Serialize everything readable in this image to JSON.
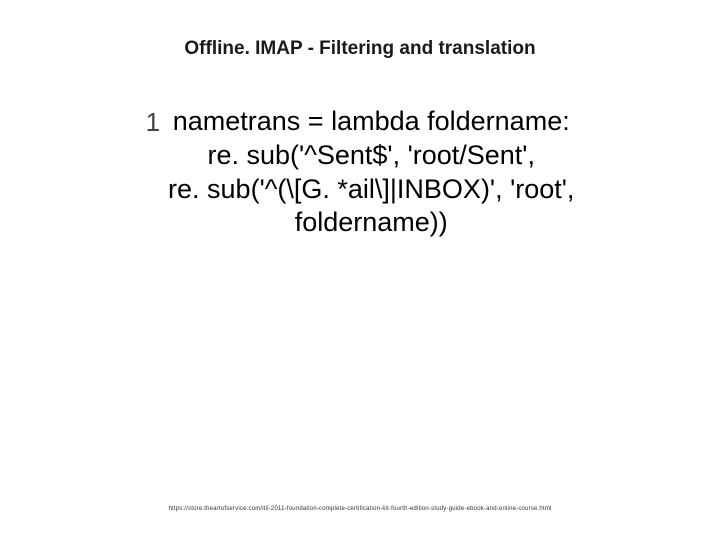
{
  "title": "Offline. IMAP -  Filtering and translation",
  "bullet_number": "1",
  "body_line1": "nametrans = lambda foldername:",
  "body_line2": "re. sub('^Sent$', 'root/Sent',",
  "body_line3": "re. sub('^(\\[G. *ail\\]|INBOX)', 'root',",
  "body_line4": "foldername))",
  "footer_link": "https://store.theartofservice.com/itil-2011-foundation-complete-certification-kit-fourth-edition-study-guide-ebook-and-online-course.html"
}
